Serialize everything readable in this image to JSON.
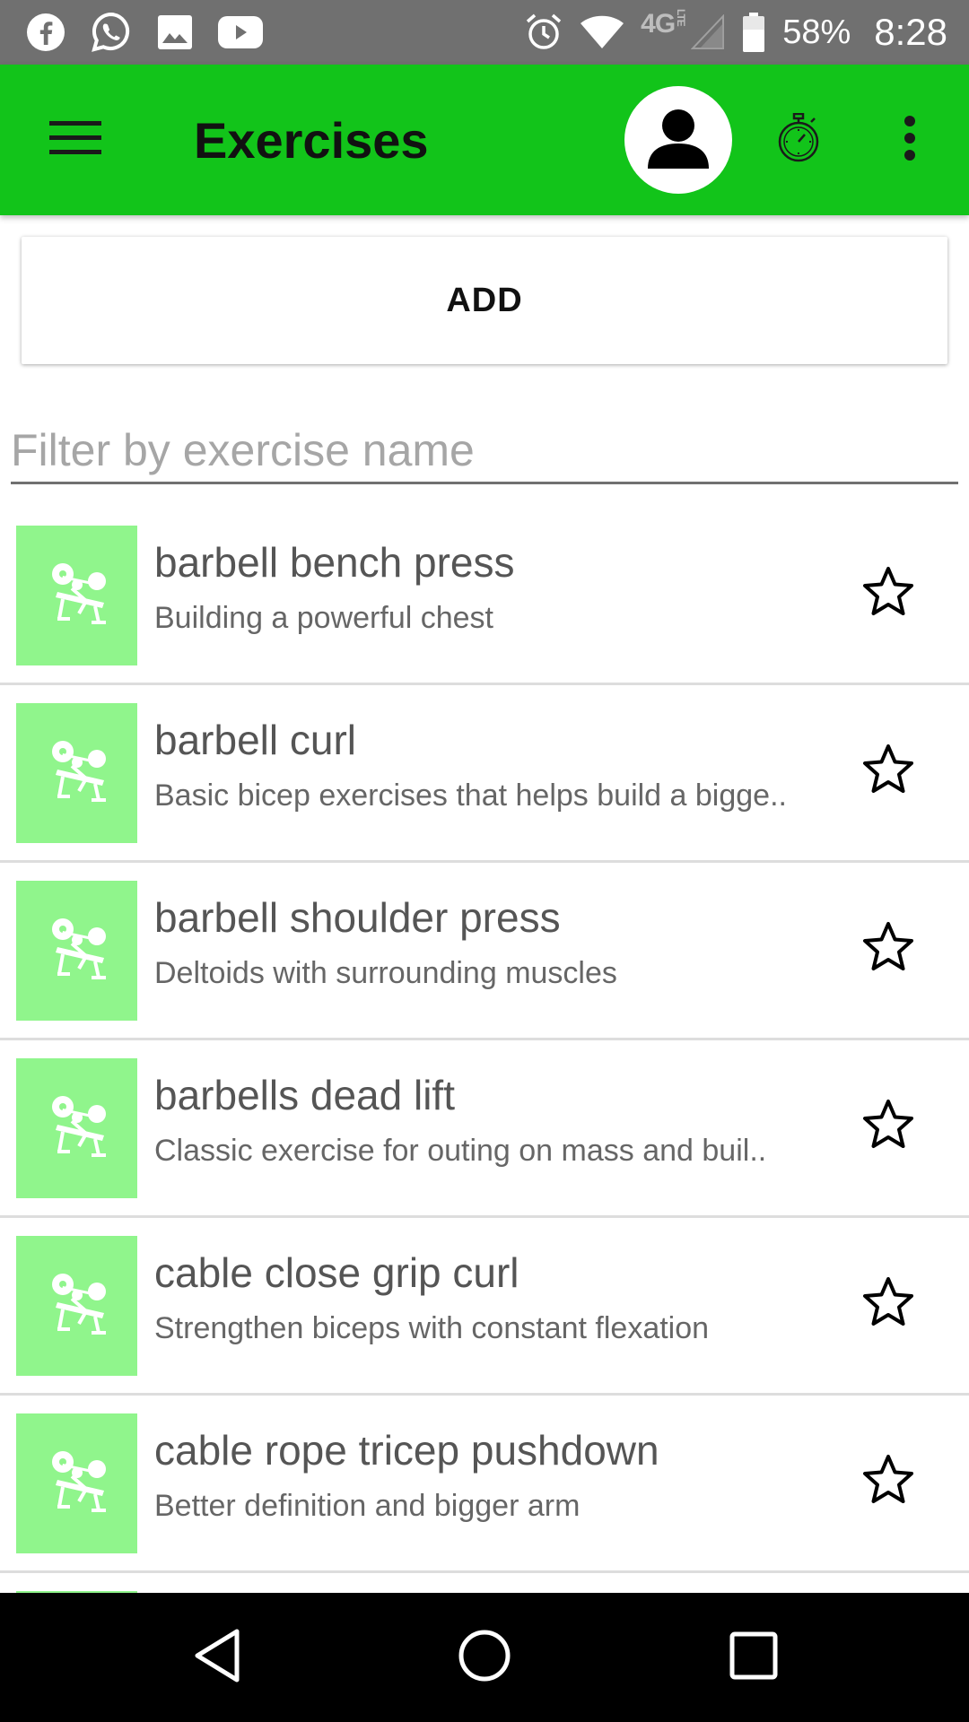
{
  "status_bar": {
    "battery_percent": "58%",
    "time": "8:28",
    "network_label": "4G",
    "network_sub": "LTE",
    "left_icons": [
      "facebook-icon",
      "whatsapp-icon",
      "image-icon",
      "youtube-icon"
    ],
    "right_icons": [
      "alarm-icon",
      "wifi-icon",
      "cell-signal-icon",
      "battery-icon"
    ]
  },
  "app_bar": {
    "title": "Exercises",
    "icons": [
      "menu-icon",
      "avatar-icon",
      "stopwatch-icon",
      "more-vert-icon"
    ]
  },
  "add_button": {
    "label": "ADD"
  },
  "filter": {
    "placeholder": "Filter by exercise name",
    "value": ""
  },
  "exercises": [
    {
      "title": "barbell bench press",
      "subtitle": "Building a powerful chest",
      "favorite": false
    },
    {
      "title": "barbell curl",
      "subtitle": "Basic bicep exercises that helps build a bigge..",
      "favorite": false
    },
    {
      "title": "barbell shoulder press",
      "subtitle": "Deltoids with surrounding muscles",
      "favorite": false
    },
    {
      "title": "barbells dead lift",
      "subtitle": "Classic exercise for outing on mass and buil..",
      "favorite": false
    },
    {
      "title": "cable close grip curl",
      "subtitle": "Strengthen biceps with constant flexation",
      "favorite": false
    },
    {
      "title": "cable rope tricep pushdown",
      "subtitle": "Better definition and bigger arm",
      "favorite": false
    },
    {
      "title": "",
      "subtitle": "",
      "favorite": false
    }
  ],
  "nav_bar": {
    "buttons": [
      "back-icon",
      "home-icon",
      "recents-icon"
    ]
  },
  "colors": {
    "status_bar": "#707070",
    "app_bar": "#12c41a",
    "thumbnail": "#90f58c",
    "nav_bar": "#000000"
  }
}
